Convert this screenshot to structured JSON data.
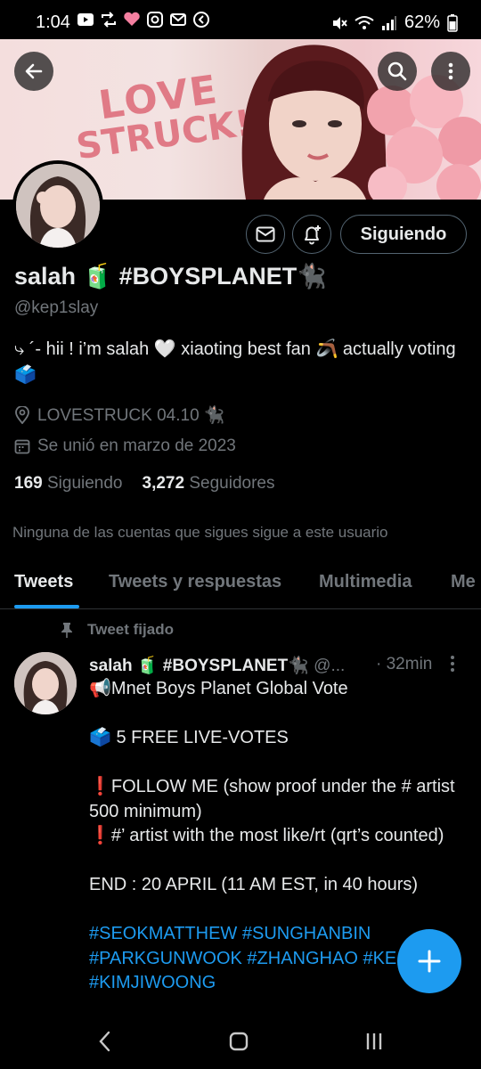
{
  "status_bar": {
    "time": "1:04",
    "battery": "62%",
    "left_icons": [
      "youtube-icon",
      "retweet-icon",
      "heart-icon",
      "instagram-icon",
      "gmail-icon",
      "shazam-icon"
    ],
    "right_icons": [
      "mute-icon",
      "wifi-icon",
      "signal-icon",
      "battery-icon"
    ]
  },
  "banner": {
    "line1": "LOVE",
    "line2": "STRUCK!",
    "colors": {
      "text": "#e07a86",
      "background": "#f3e3e2"
    }
  },
  "header_buttons": {
    "back": "back-arrow-icon",
    "search": "search-icon",
    "more": "more-vertical-icon"
  },
  "profile": {
    "display_name": "salah 🧃 #BOYSPLANET🐈‍⬛",
    "handle": "@kep1slay",
    "bio": "⤷ ´- hii ! i’m salah 🤍 xiaoting best fan 🪃 actually voting 🗳️",
    "location": "LOVESTRUCK 04.10 🐈‍⬛",
    "joined": "Se unió en marzo de 2023",
    "following_count": "169",
    "following_label": "Siguiendo",
    "followers_count": "3,272",
    "followers_label": "Seguidores",
    "mutuals_text": "Ninguna de las cuentas que sigues sigue a este usuario",
    "follow_button": "Siguiendo"
  },
  "tabs": [
    {
      "label": "Tweets",
      "active": true
    },
    {
      "label": "Tweets y respuestas",
      "active": false
    },
    {
      "label": "Multimedia",
      "active": false
    },
    {
      "label": "Me",
      "active": false
    }
  ],
  "pinned_tweet": {
    "pinned_label": "Tweet fijado",
    "author_name": "salah 🧃 #BOYSPLANET🐈‍⬛",
    "author_handle": "@...",
    "time": "· 32min",
    "lines": [
      "📢Mnet Boys Planet Global Vote",
      "",
      "🗳️ 5 FREE LIVE-VOTES",
      "",
      "❗FOLLOW ME (show proof under the # artist 500 minimum)",
      "❗#’ artist with the most like/rt (qrt’s counted)",
      "",
      "END : 20 APRIL (11 AM EST, in 40 hours)",
      ""
    ],
    "hashtags_line1": "#SEOKMATTHEW #SUNGHANBIN",
    "hashtags_line2": "#PARKGUNWOOK #ZHANGHAO #KE",
    "hashtags_line3": "#KIMJIWOONG"
  },
  "accent_color": "#1d9bf0",
  "nav_bar": [
    "back-nav-icon",
    "home-nav-icon",
    "recents-nav-icon"
  ]
}
